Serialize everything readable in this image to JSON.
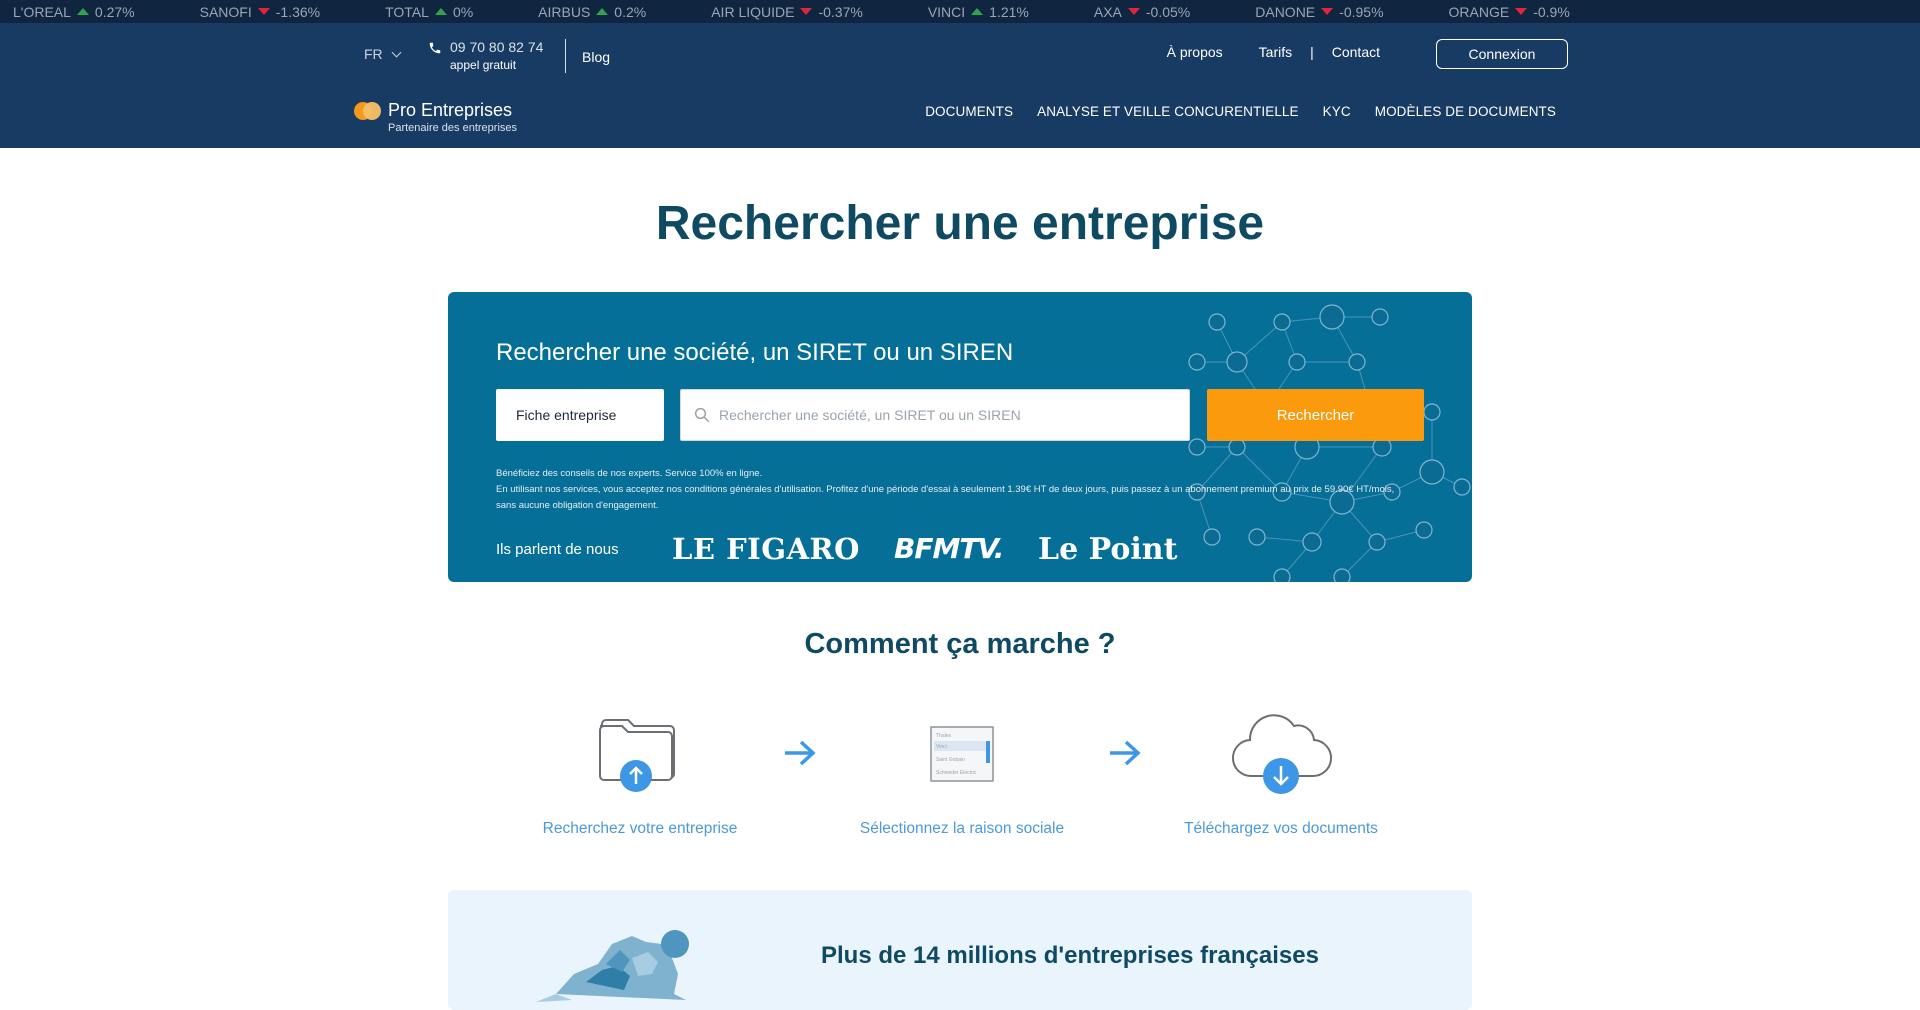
{
  "ticker": [
    {
      "name": "L'OREAL",
      "dir": "up",
      "change": "0.27%"
    },
    {
      "name": "SANOFI",
      "dir": "down",
      "change": "-1.36%"
    },
    {
      "name": "TOTAL",
      "dir": "up",
      "change": "0%"
    },
    {
      "name": "AIRBUS",
      "dir": "up",
      "change": "0.2%"
    },
    {
      "name": "AIR LIQUIDE",
      "dir": "down",
      "change": "-0.37%"
    },
    {
      "name": "VINCI",
      "dir": "up",
      "change": "1.21%"
    },
    {
      "name": "AXA",
      "dir": "down",
      "change": "-0.05%"
    },
    {
      "name": "DANONE",
      "dir": "down",
      "change": "-0.95%"
    },
    {
      "name": "ORANGE",
      "dir": "down",
      "change": "-0.9%"
    }
  ],
  "header": {
    "lang": "FR",
    "phone": "09 70 80 82 74",
    "phone_note": "appel gratuit",
    "blog": "Blog",
    "links": [
      "À propos",
      "Tarifs",
      "Contact"
    ],
    "login": "Connexion",
    "brand": "Pro Entreprises",
    "tagline": "Partenaire des entreprises",
    "nav": [
      "DOCUMENTS",
      "ANALYSE ET VEILLE CONCURENTIELLE",
      "KYC",
      "MODÈLES DE DOCUMENTS"
    ]
  },
  "hero": {
    "title": "Rechercher une entreprise",
    "card_title": "Rechercher une société, un SIRET ou un SIREN",
    "type_select": "Fiche entreprise",
    "search_placeholder": "Rechercher une société, un SIRET ou un SIREN",
    "search_button": "Rechercher",
    "fine_1": "Bénéficiez des conseils de nos experts. Service 100% en ligne.",
    "fine_2": "En utilisant nos services, vous acceptez nos conditions générales d'utilisation. Profitez d'une période d'essai à seulement 1.39€ HT de deux jours, puis passez à un abonnement premium au prix de 59.90€ HT/mois,",
    "fine_3": "sans aucune obligation d'engagement.",
    "press_label": "Ils parlent de nous",
    "press": [
      "LE FIGARO",
      "BFMTV.",
      "Le Point"
    ]
  },
  "how": {
    "title": "Comment ça marche ?",
    "steps": [
      "Recherchez votre entreprise",
      "Sélectionnez la raison sociale",
      "Téléchargez vos documents"
    ],
    "list_items": [
      "Thales",
      "Vinci",
      "Saint Gobain",
      "Schneider Electric"
    ]
  },
  "stats": {
    "title": "Plus de 14 millions d'entreprises françaises"
  },
  "colors": {
    "header_bg": "#183b63",
    "ticker_bg": "#0f2540",
    "card_bg": "#066f98",
    "accent_orange": "#fb9a0c",
    "title_color": "#0f4a63",
    "step_blue": "#4b9ad7"
  }
}
